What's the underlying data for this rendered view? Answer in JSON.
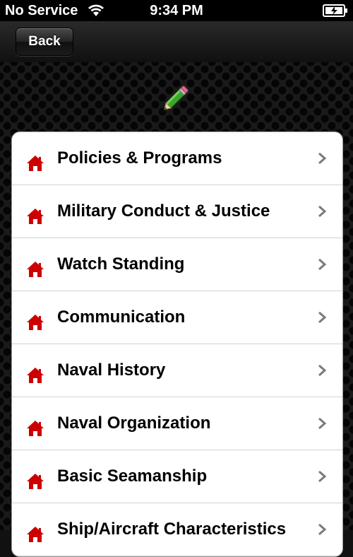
{
  "status_bar": {
    "carrier": "No Service",
    "time": "9:34 PM",
    "wifi_icon": "wifi-icon",
    "battery_icon": "battery-icon"
  },
  "nav": {
    "back_label": "Back"
  },
  "header_icon": "pencil-icon",
  "colors": {
    "home_icon": "#cc0000",
    "chevron": "#7a7a7a",
    "list_bg": "#ffffff",
    "separator": "#d2d2d2"
  },
  "menu": {
    "items": [
      {
        "label": "Policies & Programs",
        "icon": "home-icon"
      },
      {
        "label": "Military Conduct & Justice",
        "icon": "home-icon"
      },
      {
        "label": "Watch Standing",
        "icon": "home-icon"
      },
      {
        "label": "Communication",
        "icon": "home-icon"
      },
      {
        "label": "Naval History",
        "icon": "home-icon"
      },
      {
        "label": "Naval Organization",
        "icon": "home-icon"
      },
      {
        "label": "Basic Seamanship",
        "icon": "home-icon"
      },
      {
        "label": "Ship/Aircraft Characteristics",
        "icon": "home-icon"
      }
    ]
  }
}
